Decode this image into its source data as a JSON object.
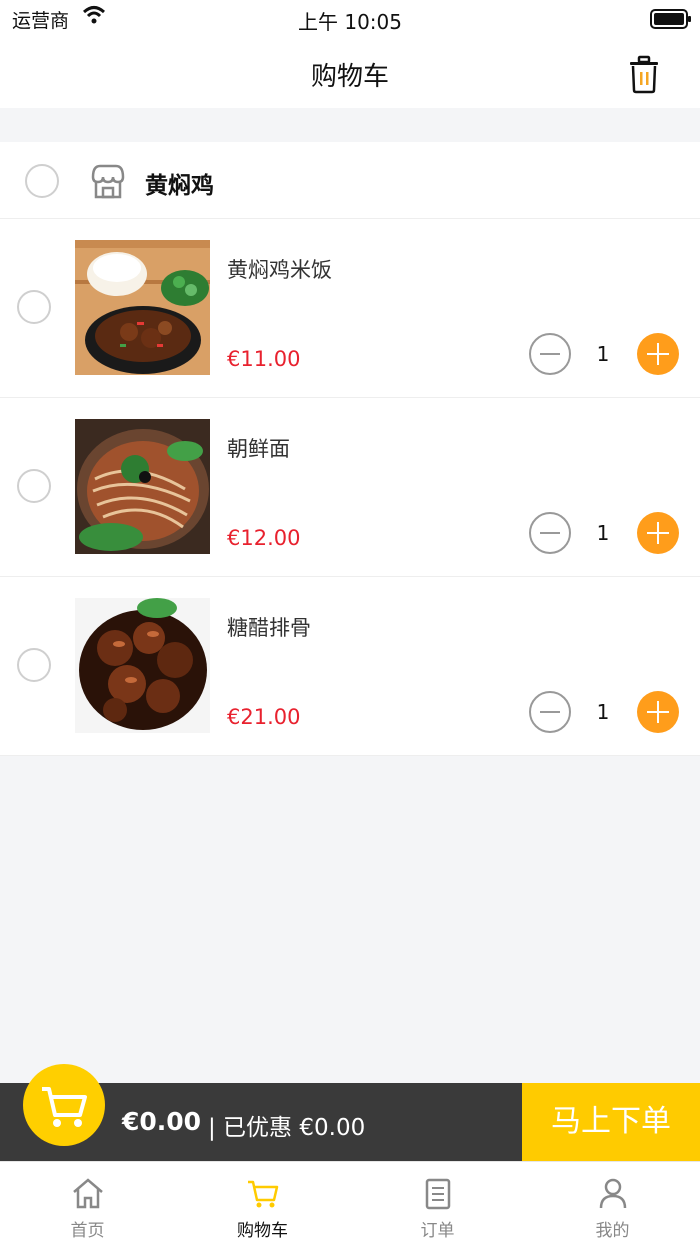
{
  "status": {
    "carrier": "运营商",
    "time": "上午 10:05"
  },
  "header": {
    "title": "购物车"
  },
  "shop": {
    "name": "黄焖鸡"
  },
  "items": [
    {
      "name": "黄焖鸡米饭",
      "price": "€11.00",
      "qty": "1"
    },
    {
      "name": "朝鲜面",
      "price": "€12.00",
      "qty": "1"
    },
    {
      "name": "糖醋排骨",
      "price": "€21.00",
      "qty": "1"
    }
  ],
  "checkout": {
    "total": "€0.00",
    "discount": "| 已优惠 €0.00",
    "order_label": "马上下单"
  },
  "tabs": [
    {
      "label": "首页"
    },
    {
      "label": "购物车"
    },
    {
      "label": "订单"
    },
    {
      "label": "我的"
    }
  ],
  "colors": {
    "accent": "#ffcb00",
    "price": "#e8212e",
    "plus": "#ff9d1b"
  }
}
